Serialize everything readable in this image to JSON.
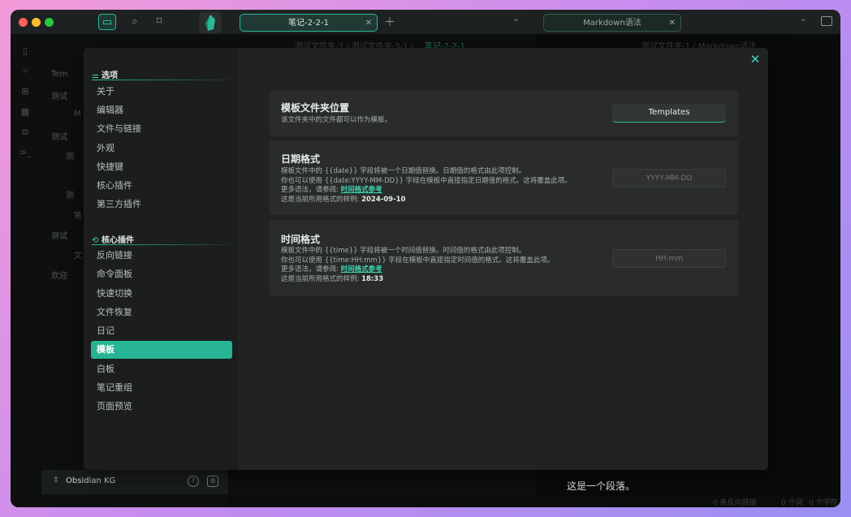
{
  "titlebar": {
    "tab1_label": "笔记-2-2-1",
    "tab2_label": "Markdown语法"
  },
  "background": {
    "tree": [
      "Tem",
      "测试",
      "M",
      "测试",
      "测",
      "测",
      "笔",
      "测试",
      "文",
      "欢迎"
    ],
    "mid_breadcrumb": "测试文件夹-3 / 测试文件夹-3-1 /",
    "mid_breadcrumb_active": "笔记-2-2-1",
    "right_breadcrumb": "测试文件夹-1 / Markdown语法",
    "paragraph": "这是一个段落。",
    "status_backlinks": "0 条反向链接",
    "status_words": "0 个词",
    "status_chars": "0 个字符"
  },
  "vault": {
    "name": "Obsidian KG"
  },
  "settings": {
    "section_options": "选项",
    "options": [
      "关于",
      "编辑器",
      "文件与链接",
      "外观",
      "快捷键",
      "核心插件",
      "第三方插件"
    ],
    "section_core": "核心插件",
    "core_plugins": [
      "反向链接",
      "命令面板",
      "快速切换",
      "文件恢复",
      "日记",
      "模板",
      "白板",
      "笔记重组",
      "页面预览"
    ],
    "active_item": "模板"
  },
  "template_folder": {
    "title": "模板文件夹位置",
    "desc": "该文件夹中的文件都可以作为模板。",
    "button": "Templates"
  },
  "date_format": {
    "title": "日期格式",
    "line1": "模板文件中的 {{date}} 字段将被一个日期值替换。日期值的格式由此项控制。",
    "line2": "你也可以使用 {{date:YYYY-MM-DD}} 字段在模板中直接指定日期值的格式。这将覆盖此项。",
    "more_prefix": "更多语法，请参阅:",
    "more_link": "时间格式参考",
    "sample_prefix": "这是当前所用格式的样例:",
    "sample_value": "2024-09-10",
    "placeholder": "YYYY-MM-DD"
  },
  "time_format": {
    "title": "时间格式",
    "line1": "模板文件中的 {{time}} 字段将被一个时间值替换。时间值的格式由此项控制。",
    "line2": "你也可以使用 {{time:HH:mm}} 字段在模板中直接指定时间值的格式。这将覆盖此项。",
    "more_prefix": "更多语法，请参阅:",
    "more_link": "时间格式参考",
    "sample_prefix": "这是当前所用格式的样例:",
    "sample_value": "18:33",
    "placeholder": "HH:mm"
  },
  "colors": {
    "accent": "#27b494",
    "modal_bg": "#212323",
    "card_bg": "#2a2c2c"
  }
}
